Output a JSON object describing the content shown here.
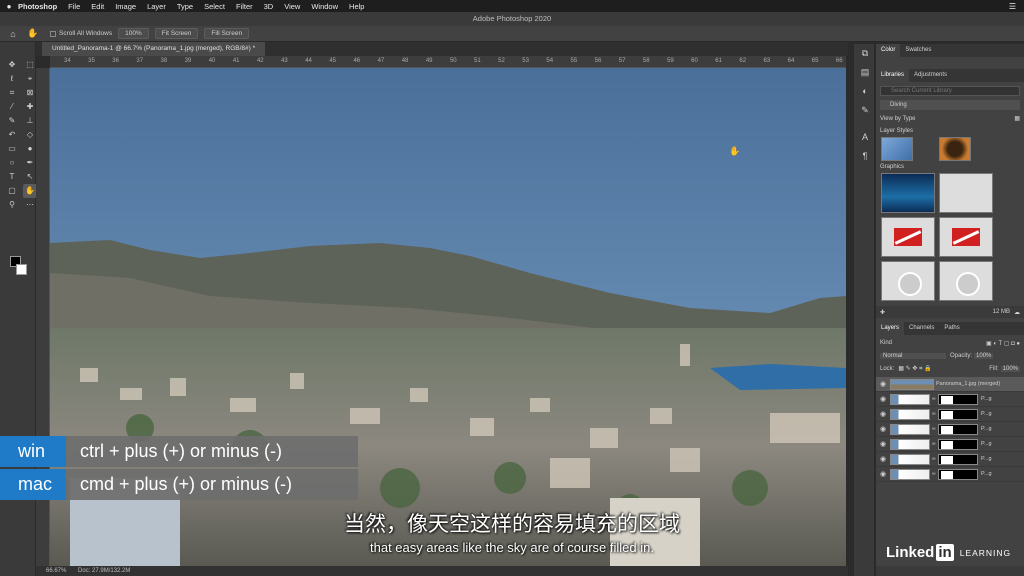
{
  "menubar": {
    "apple_icon": "apple-icon",
    "items": [
      "Photoshop",
      "File",
      "Edit",
      "Image",
      "Layer",
      "Type",
      "Select",
      "Filter",
      "3D",
      "View",
      "Window",
      "Help"
    ]
  },
  "titlebar": {
    "title": "Adobe Photoshop 2020"
  },
  "options": {
    "scroll_all": "Scroll All Windows",
    "zoom": "100%",
    "fit_screen": "Fit Screen",
    "fill_screen": "Fill Screen"
  },
  "document": {
    "tab_label": "Untitled_Panorama-1 @ 66.7% (Panorama_1.jpg (merged), RGB/8#) *",
    "ruler_ticks": [
      "34",
      "35",
      "36",
      "37",
      "38",
      "39",
      "40",
      "41",
      "42",
      "43",
      "44",
      "45",
      "46",
      "47",
      "48",
      "49",
      "50",
      "51",
      "52",
      "53",
      "54",
      "55",
      "56",
      "57",
      "58",
      "59",
      "60",
      "61",
      "62",
      "63",
      "64",
      "65",
      "66"
    ]
  },
  "status": {
    "zoom": "66.67%",
    "doc": "Doc: 27.9M/132.2M"
  },
  "shortcuts": [
    {
      "os": "win",
      "keys": "ctrl + plus (+) or minus (-)"
    },
    {
      "os": "mac",
      "keys": "cmd + plus (+) or minus (-)"
    }
  ],
  "subtitles": {
    "cn": "当然，像天空这样的容易填充的区域",
    "en": "that easy areas like the sky are of course filled in."
  },
  "right_panel": {
    "color_tabs": [
      "Color",
      "Swatches"
    ],
    "library_tabs": [
      "Libraries",
      "Adjustments"
    ],
    "search_placeholder": "Search Current Library",
    "library_name": "Diving",
    "view_by": "View by Type",
    "layer_styles": "Layer Styles",
    "graphics": "Graphics",
    "size": "12 MB",
    "layer_tabs": [
      "Layers",
      "Channels",
      "Paths"
    ],
    "kind": "Kind",
    "blend_mode": "Normal",
    "opacity_label": "Opacity:",
    "opacity": "100%",
    "lock_label": "Lock:",
    "fill_label": "Fill:",
    "fill": "100%",
    "layers": [
      {
        "name": "Panorama_1.jpg (merged)",
        "selected": true
      },
      {
        "name": "P...g"
      },
      {
        "name": "P...g"
      },
      {
        "name": "P...g"
      },
      {
        "name": "P...g"
      },
      {
        "name": "P...g"
      },
      {
        "name": "P...g"
      }
    ]
  },
  "branding": {
    "linked": "Linked",
    "in": "in",
    "learning": "LEARNING"
  }
}
